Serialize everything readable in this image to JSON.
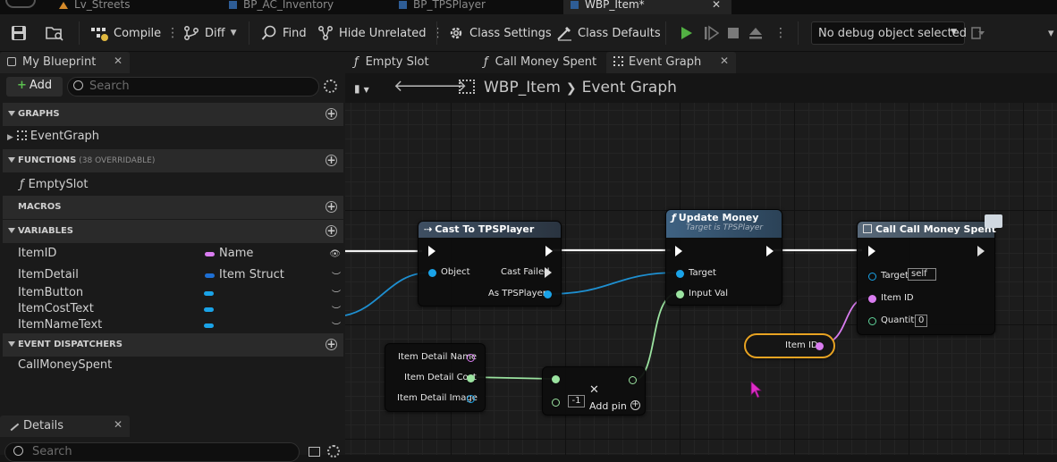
{
  "doc_tabs": [
    {
      "label": "Lv_Streets",
      "active": false
    },
    {
      "label": "BP_AC_Inventory",
      "active": false
    },
    {
      "label": "BP_TPSPlayer",
      "active": false
    },
    {
      "label": "WBP_Item*",
      "active": true
    }
  ],
  "toolbar": {
    "compile": "Compile",
    "diff": "Diff",
    "find": "Find",
    "hide_unrelated": "Hide Unrelated",
    "class_settings": "Class Settings",
    "class_defaults": "Class Defaults",
    "debug_object": "No debug object selected"
  },
  "my_blueprint": {
    "tab_label": "My Blueprint",
    "add_label": "Add",
    "search_placeholder": "Search",
    "graphs_header": "GRAPHS",
    "graphs": [
      "EventGraph"
    ],
    "functions_header": "FUNCTIONS",
    "functions_sub": "(38 OVERRIDABLE)",
    "functions": [
      "EmptySlot"
    ],
    "macros_header": "MACROS",
    "variables_header": "VARIABLES",
    "variables": [
      {
        "name": "ItemID",
        "type": "Name",
        "color": "#d97cf0"
      },
      {
        "name": "ItemDetail",
        "type": "Item Struct",
        "color": "#1e6fd4"
      },
      {
        "name": "ItemButton",
        "type": "",
        "color": "#1aa3e8"
      },
      {
        "name": "ItemCostText",
        "type": "",
        "color": "#1aa3e8"
      },
      {
        "name": "ItemNameText",
        "type": "",
        "color": "#1aa3e8"
      }
    ],
    "dispatchers_header": "EVENT DISPATCHERS",
    "dispatchers": [
      "CallMoneySpent"
    ]
  },
  "details": {
    "tab_label": "Details",
    "search_placeholder": "Search"
  },
  "graph_tabs": [
    {
      "label": "Empty Slot",
      "active": false
    },
    {
      "label": "Call Money Spent",
      "active": false
    },
    {
      "label": "Event Graph",
      "active": true
    }
  ],
  "breadcrumb": {
    "blueprint": "WBP_Item",
    "graph": "Event Graph"
  },
  "nodes": {
    "cast": {
      "title": "Cast To TPSPlayer",
      "object": "Object",
      "cast_failed": "Cast Failed",
      "as_player": "As TPSPlayer"
    },
    "update_money": {
      "title": "Update Money",
      "subtitle": "Target is TPSPlayer",
      "target": "Target",
      "input_val": "Input Val"
    },
    "call_money": {
      "title": "Call Call Money Spent",
      "target": "Target",
      "target_value": "self",
      "item_id": "Item ID",
      "quantity": "Quantity",
      "quantity_value": "0"
    },
    "break_struct": {
      "name": "Item Detail Name",
      "cost": "Item Detail Cost",
      "image": "Item Detail Image"
    },
    "multiply": {
      "value": "-1",
      "add_pin": "Add pin"
    },
    "item_id_getter": {
      "label": "Item ID"
    }
  },
  "colors": {
    "exec": "#ffffff",
    "object": "#1aa3e8",
    "name": "#d97cf0",
    "float": "#9be3a0",
    "cast_header": "#3e4f62",
    "function_header": "#3f6282",
    "event_call_header": "#58697a",
    "selected_outline": "#e8a322"
  }
}
